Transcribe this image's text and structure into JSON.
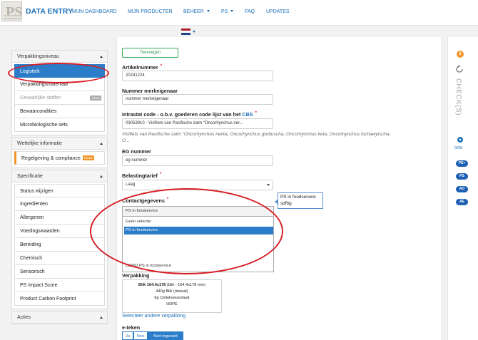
{
  "header": {
    "brand": "DATA ENTRY",
    "nav": [
      "MIJN DASHBOARD",
      "MIJN PRODUCTEN",
      "BEHEER",
      "PS",
      "FAQ",
      "UPDATES"
    ]
  },
  "sidebar": {
    "sections": [
      {
        "title": "Verpakkingsniveau",
        "items": [
          "Logistiek",
          "Verpakkingsmateriaal",
          "Gevaarlijke stoffen",
          "Bewaarcondities",
          "Microbiologische sets"
        ],
        "badge": "niesw"
      },
      {
        "title": "Wettelijke informatie",
        "items": [
          "Regelgeving & compliance"
        ],
        "badge": "nieuw"
      },
      {
        "title": "Specificatie",
        "items": [
          "Status wijzigen",
          "Ingrediënten",
          "Allergenen",
          "Voedingswaarden",
          "Bereiding",
          "Chemisch",
          "Sensorisch",
          "PS Impact Score",
          "Product Carbon Footprint"
        ]
      },
      {
        "title": "Acties",
        "items": []
      }
    ]
  },
  "form": {
    "add_button": "Toevoegen",
    "artikelnummer": {
      "label": "Artikelnummer",
      "value": "20241224"
    },
    "merkeigenaar": {
      "label": "Nummer merkeigenaar",
      "value": "nummer merkeigenaar"
    },
    "intrastat": {
      "label": "Intrastat code - o.b.v. goederen code lijst van het",
      "link": "CBS",
      "value": "03053910 - Visfilets van Pacifische zalm \"Oncorhynchus ner...",
      "help1": "Visfilets van Pacifische zalm \"Oncorhynchus nerka, Oncorhynchus gorbuscha, Oncorhynchus keta, Oncorhynchus tschawytscha,",
      "help2": "O..."
    },
    "eg_nummer": {
      "label": "EG nummer",
      "value": "eg nummer"
    },
    "belastingtarief": {
      "label": "Belastingtarief",
      "value": "Laag"
    },
    "contactgegevens": {
      "label": "Contactgegevens",
      "value": "PS in foodservice",
      "options": [
        "Geen selectie",
        "PS in foodservice",
        "DEMO PS in foodservice"
      ],
      "tooltip": [
        "PS in foodservice",
        "sdfbg"
      ]
    },
    "verpakking": {
      "label": "Verpakking",
      "lines": [
        "Blik 164.4x178",
        "(blik - 164.4x178 mm)",
        "440g Blik (metaal)",
        "6g Celluloseacetaat",
        "HDPE"
      ],
      "link": "Selecteer andere verpakking"
    },
    "e_teken": {
      "label": "e-teken",
      "options": [
        "Ja",
        "Nee",
        "Niet ingevuld"
      ],
      "selected": "Niet ingevuld"
    }
  },
  "right_panel": {
    "badge": "1",
    "check_label": "CHECK(S)",
    "info_label": "Info",
    "pills": [
      "PS+",
      "PS",
      "AO",
      "AE"
    ]
  },
  "colors": {
    "brand": "#1b6fb8",
    "active": "#2c7dc9",
    "highlight_ring": "#d81e26",
    "add_green": "#38a858",
    "badge_orange": "#f0962a"
  }
}
